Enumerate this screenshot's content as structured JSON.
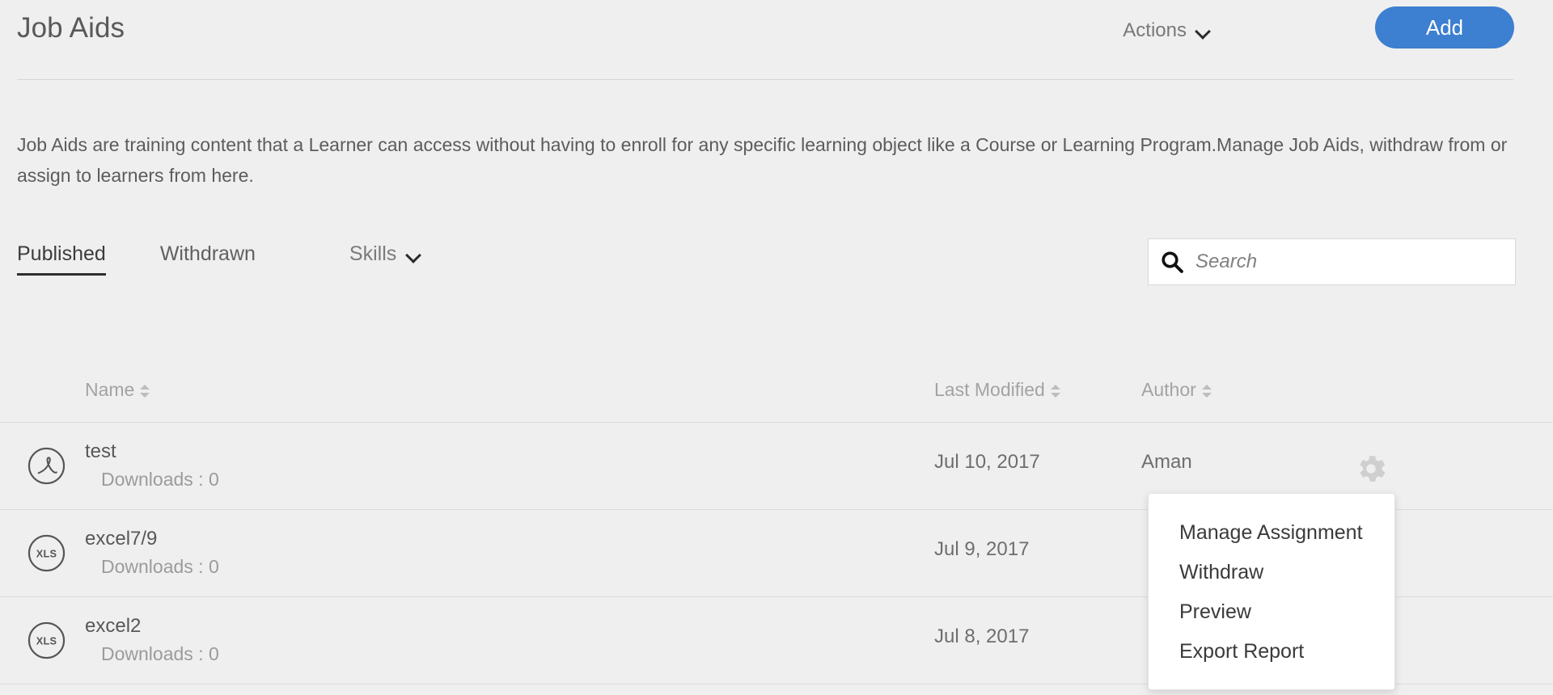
{
  "header": {
    "title": "Job Aids",
    "actions_label": "Actions",
    "add_label": "Add",
    "accent_color": "#3d7fd0",
    "chevron_icon": "chevron-down-icon"
  },
  "description": "Job Aids are training content that a Learner can access without having to enroll for any specific learning object like a Course or Learning Program.Manage Job Aids, withdraw from or assign to learners from here.",
  "tabs": [
    {
      "label": "Published",
      "active": true
    },
    {
      "label": "Withdrawn",
      "active": false
    }
  ],
  "skills_filter": {
    "label": "Skills",
    "chevron_icon": "chevron-down-icon"
  },
  "search": {
    "placeholder": "Search",
    "value": "",
    "icon": "search-icon"
  },
  "table": {
    "columns": [
      {
        "label": "Name",
        "sortable": true
      },
      {
        "label": "Last Modified",
        "sortable": true
      },
      {
        "label": "Author",
        "sortable": true
      }
    ],
    "downloads_prefix": "Downloads : ",
    "rows": [
      {
        "icon": "pdf-file-icon",
        "name": "test",
        "downloads": "Downloads : 0",
        "last_modified": "Jul 10, 2017",
        "author": "Aman",
        "gear_icon": "gear-icon"
      },
      {
        "icon": "xls-file-icon",
        "name": "excel7/9",
        "downloads": "Downloads : 0",
        "last_modified": "Jul 9, 2017",
        "author": "",
        "gear_icon": "gear-icon"
      },
      {
        "icon": "xls-file-icon",
        "name": "excel2",
        "downloads": "Downloads : 0",
        "last_modified": "Jul 8, 2017",
        "author": "",
        "gear_icon": "gear-icon"
      }
    ]
  },
  "context_menu": {
    "items": [
      {
        "label": "Manage Assignment"
      },
      {
        "label": "Withdraw"
      },
      {
        "label": "Preview"
      },
      {
        "label": "Export Report"
      }
    ]
  },
  "xls_icon_label": "XLS"
}
